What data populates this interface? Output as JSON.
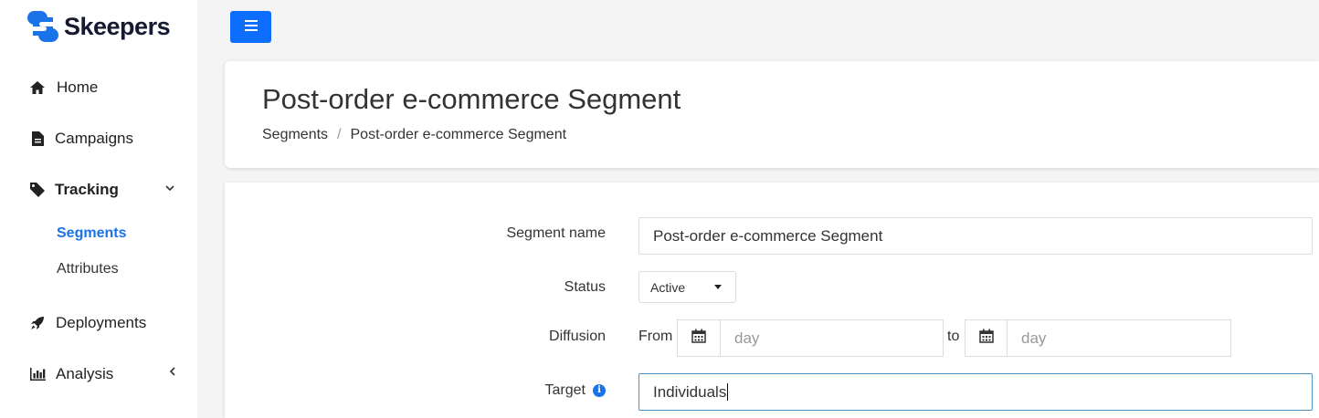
{
  "brand": {
    "name": "Skeepers",
    "color": "#1a73e8"
  },
  "sidebar": {
    "items": [
      {
        "label": "Home",
        "icon": "home-icon"
      },
      {
        "label": "Campaigns",
        "icon": "document-icon"
      },
      {
        "label": "Tracking",
        "icon": "tag-icon",
        "expanded": true
      },
      {
        "label": "Segments",
        "active": true
      },
      {
        "label": "Attributes"
      },
      {
        "label": "Deployments",
        "icon": "rocket-icon"
      },
      {
        "label": "Analysis",
        "icon": "bar-chart-icon",
        "expanded": false
      }
    ]
  },
  "header": {
    "title": "Post-order e-commerce Segment",
    "breadcrumb": [
      "Segments",
      "Post-order e-commerce Segment"
    ]
  },
  "form": {
    "segment_name": {
      "label": "Segment name",
      "value": "Post-order e-commerce Segment"
    },
    "status": {
      "label": "Status",
      "value": "Active"
    },
    "diffusion": {
      "label": "Diffusion",
      "from_label": "From",
      "to_label": "to",
      "from_placeholder": "day",
      "to_placeholder": "day"
    },
    "target": {
      "label": "Target",
      "value": "Individuals"
    }
  },
  "colors": {
    "accent": "#0d6efd",
    "active_link": "#1a73e8",
    "focus_border": "#4a90c2"
  }
}
